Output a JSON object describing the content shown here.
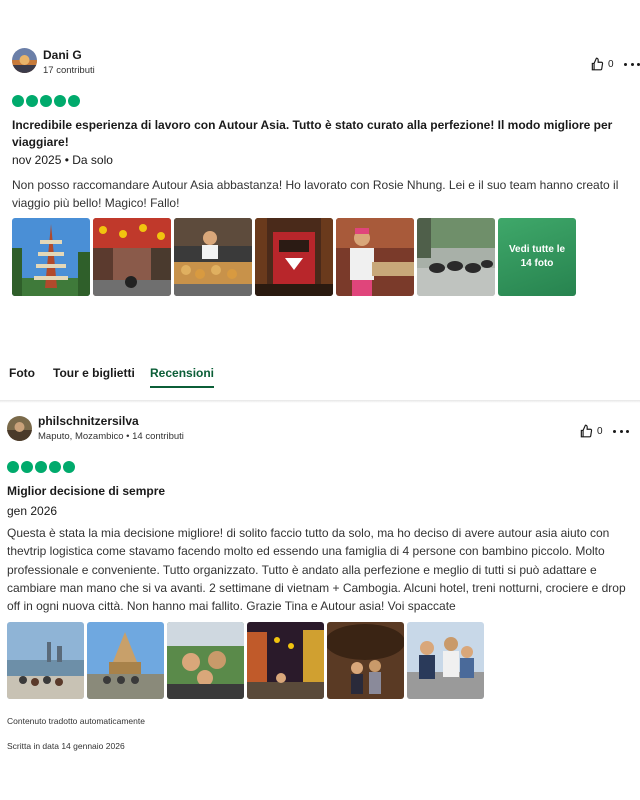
{
  "review_1": {
    "user_name": "Dani G",
    "user_meta": "17 contributi",
    "likes": "0",
    "rating_bubbles": 5,
    "title": "Incredibile esperienza di lavoro con Autour Asia. Tutto è stato curato alla perfezione! Il modo migliore per viaggiare!",
    "date_line": "nov 2025 • Da solo",
    "body": "Non posso raccomandare Autour Asia abbastanza! Ho lavorato con Rosie Nhung. Lei e il suo team hanno creato il viaggio più bello! Magico! Fallo!",
    "see_all_line1": "Vedi tutte le",
    "see_all_line2": "14 foto",
    "icons": {
      "like": "thumbs-up-icon",
      "more": "more-options-icon",
      "bubble": "rating-bubble-icon"
    }
  },
  "tabs": [
    {
      "label": "Foto"
    },
    {
      "label": "Tour e biglietti"
    },
    {
      "label": "Recensioni",
      "active": true
    }
  ],
  "review_2": {
    "user_name": "philschnitzersilva",
    "user_meta": "Maputo, Mozambico • 14 contributi",
    "likes": "0",
    "rating_bubbles": 5,
    "title": "Miglior decisione di sempre",
    "date_line": "gen 2026",
    "body": "Questa è stata la mia decisione migliore! di solito faccio tutto da solo, ma ho deciso di avere autour asia aiuto con thevtrip logistica come stavamo facendo molto ed essendo una famiglia di 4 persone con bambino piccolo. Molto professionale e conveniente. Tutto organizzato. Tutto è andato alla perfezione e meglio di tutti si può adattare e cambiare man mano che si va avanti. 2 settimane di vietnam + Cambogia. Alcuni hotel, treni notturni, crociere e drop off in ogni nuova città. Non hanno mai fallito. Grazie Tina e Autour asia! Voi spaccate",
    "translated_note": "Contenuto tradotto automaticamente",
    "written_date": "Scritta in data 14 gennaio 2026"
  },
  "colors": {
    "rating_green": "#00aa6c",
    "active_tab": "#0b5e37",
    "see_all_tile": "#3fa86a"
  }
}
